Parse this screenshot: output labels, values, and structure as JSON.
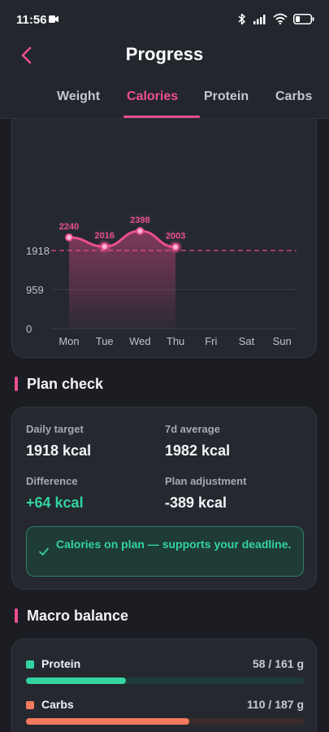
{
  "status_bar": {
    "time": "11:56",
    "battery_level": 0.3
  },
  "header": {
    "title": "Progress",
    "tabs": [
      {
        "label": "Weight",
        "active": false
      },
      {
        "label": "Calories",
        "active": true
      },
      {
        "label": "Protein",
        "active": false
      },
      {
        "label": "Carbs",
        "active": false
      }
    ]
  },
  "chart_data": {
    "type": "area",
    "categories": [
      "Mon",
      "Tue",
      "Wed",
      "Thu",
      "Fri",
      "Sat",
      "Sun"
    ],
    "values": [
      2240,
      2016,
      2398,
      2003,
      null,
      null,
      null
    ],
    "value_labels": [
      "2240",
      "2016",
      "2398",
      "2003"
    ],
    "ytick_labels": [
      "0",
      "959",
      "1918"
    ],
    "target": 1918,
    "ylim": [
      0,
      2878
    ],
    "grid": true,
    "colors": {
      "line": "#ec4f8f",
      "target": "#ec4f8f",
      "fill": "#ec4f8f"
    }
  },
  "plan_check": {
    "title": "Plan check",
    "daily_target_label": "Daily target",
    "daily_target_value": "1918 kcal",
    "avg_label": "7d average",
    "avg_value": "1982 kcal",
    "difference_label": "Difference",
    "difference_value": "+64 kcal",
    "adjustment_label": "Plan adjustment",
    "adjustment_value": "-389 kcal",
    "notice": "Calories on plan — supports your deadline."
  },
  "macro_balance": {
    "title": "Macro balance",
    "items": [
      {
        "name": "Protein",
        "amount": "58 / 161 g",
        "fraction": 0.36,
        "color": "#34d3a0",
        "track": "#1f3b37"
      },
      {
        "name": "Carbs",
        "amount": "110 / 187 g",
        "fraction": 0.588,
        "color": "#f47a5f",
        "track": "#3b2b2b"
      }
    ]
  },
  "colors": {
    "accent": "#ec4f8f",
    "positive": "#34d3a0",
    "background": "#1b1d23",
    "card": "#25282f"
  }
}
